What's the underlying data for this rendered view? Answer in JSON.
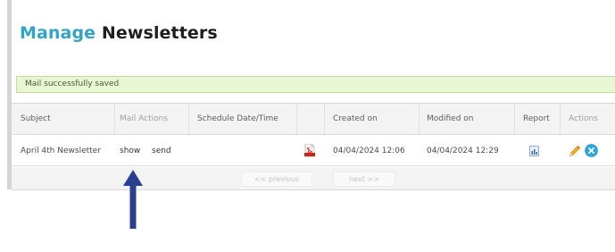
{
  "page": {
    "title_highlight": "Manage",
    "title_rest": "Newsletters"
  },
  "notice": {
    "message": "Mail successfully saved",
    "background": "#e9f6d4"
  },
  "table": {
    "columns": {
      "subject": "Subject",
      "mail_actions": "Mail Actions",
      "schedule": "Schedule Date/Time",
      "created": "Created on",
      "modified": "Modified on",
      "report": "Report",
      "actions": "Actions"
    },
    "rows": [
      {
        "subject": "April 4th Newsletter",
        "show": "show",
        "send": "send",
        "schedule": "",
        "attachment_icon": "pdf-icon",
        "created": "04/04/2024 12:06",
        "modified": "04/04/2024 12:29",
        "report_icon": "report-icon",
        "action_icons": [
          "edit-icon",
          "delete-icon"
        ]
      }
    ]
  },
  "pager": {
    "previous": "<< previous",
    "next": "next >>"
  },
  "colors": {
    "accent": "#2fa6c9",
    "arrow": "#2a3f8f"
  }
}
